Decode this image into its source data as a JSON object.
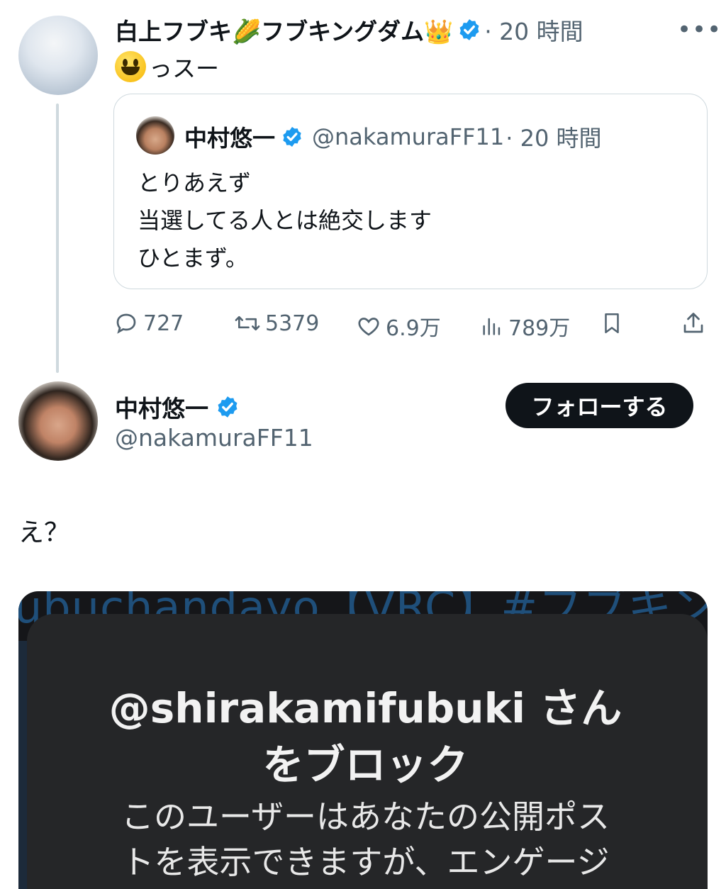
{
  "quoting_tweet": {
    "author_name": "白上フブキ🌽フブキングダム👑",
    "time": "· 20 時間",
    "more_icon": "more-dots-icon",
    "text": "っスー",
    "emoji": "smiley-face-icon"
  },
  "quoted_tweet": {
    "author_name": "中村悠一",
    "handle": "@nakamuraFF11",
    "time": "· 20 時間",
    "lines": [
      "とりあえず",
      "当選してる人とは絶交します",
      "ひとまず。"
    ]
  },
  "actions": {
    "replies": "727",
    "reposts": "5379",
    "likes": "6.9万",
    "views": "789万"
  },
  "profile": {
    "name": "中村悠一",
    "handle": "@nakamuraFF11",
    "follow_label": "フォローする"
  },
  "main_tweet": {
    "text": "え？"
  },
  "media": {
    "background_text": "ubuchandayo【VRC】#フブキングダム",
    "dialog_title_line1": "@shirakamifubuki さん",
    "dialog_title_line2": "をブロック",
    "dialog_body_line1": "このユーザーはあなたの公開ポス",
    "dialog_body_line2": "トを表示できますが、エンゲージ"
  },
  "colors": {
    "verified_blue": "#1d9bf0",
    "follow_button": "#0f1419",
    "secondary_text": "#536471"
  }
}
